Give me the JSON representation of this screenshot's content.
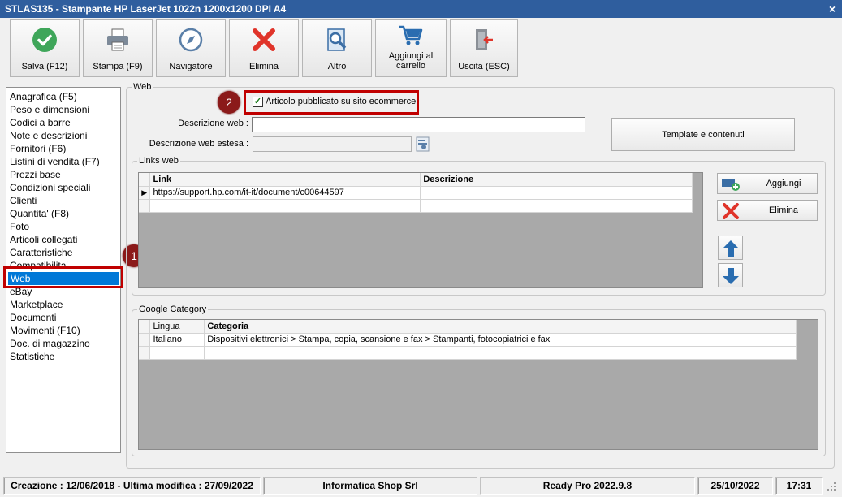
{
  "window": {
    "title": "STLAS135 - Stampante HP LaserJet 1022n 1200x1200 DPI A4",
    "close_glyph": "×"
  },
  "toolbar": [
    {
      "label": "Salva (F12)",
      "icon": "check-circle-icon"
    },
    {
      "label": "Stampa (F9)",
      "icon": "printer-icon"
    },
    {
      "label": "Navigatore",
      "icon": "compass-icon"
    },
    {
      "label": "Elimina",
      "icon": "x-delete-icon"
    },
    {
      "label": "Altro",
      "icon": "document-search-icon"
    },
    {
      "label": "Aggiungi al carrello",
      "icon": "shopping-cart-icon"
    },
    {
      "label": "Uscita (ESC)",
      "icon": "exit-door-icon"
    }
  ],
  "nav": {
    "items": [
      "Anagrafica (F5)",
      "Peso e dimensioni",
      "Codici a barre",
      "Note e descrizioni",
      "Fornitori (F6)",
      "Listini di vendita (F7)",
      "Prezzi base",
      "Condizioni speciali",
      "Clienti",
      "Quantita' (F8)",
      "Foto",
      "Articoli collegati",
      "Caratteristiche",
      "Compatibilita'",
      "Web",
      "eBay",
      "Marketplace",
      "Documenti",
      "Movimenti (F10)",
      "Doc. di magazzino",
      "Statistiche"
    ],
    "selected": "Web"
  },
  "badges": {
    "one": "1",
    "two": "2"
  },
  "web_group": {
    "title": "Web",
    "published_checkbox": {
      "label": "Articolo pubblicato su sito ecommerce",
      "checked": true,
      "glyph": "✓"
    },
    "descrizione_web": {
      "label": "Descrizione web :",
      "value": ""
    },
    "descrizione_estesa": {
      "label": "Descrizione web estesa :",
      "value": ""
    },
    "template_button": "Template e contenuti"
  },
  "links_group": {
    "title": "Links web",
    "columns": [
      "Link",
      "Descrizione"
    ],
    "rows": [
      {
        "link": "https://support.hp.com/it-it/document/c00644597",
        "descrizione": ""
      }
    ],
    "current_row_glyph": "▶",
    "add_button": "Aggiungi",
    "delete_button": "Elimina"
  },
  "google_group": {
    "title": "Google Category",
    "columns": [
      "Lingua",
      "Categoria"
    ],
    "rows": [
      {
        "lingua": "Italiano",
        "categoria": "Dispositivi elettronici > Stampa, copia, scansione e fax > Stampanti, fotocopiatrici e fax"
      }
    ]
  },
  "status": {
    "created": "Creazione : 12/06/2018 - Ultima modifica : 27/09/2022",
    "company": "Informatica Shop Srl",
    "version": "Ready Pro 2022.9.8",
    "date": "25/10/2022",
    "time": "17:31"
  },
  "colors": {
    "titlebar": "#2f5e9e",
    "selection": "#0078d7",
    "highlight": "#c00000",
    "badge": "#8b1a1a"
  }
}
